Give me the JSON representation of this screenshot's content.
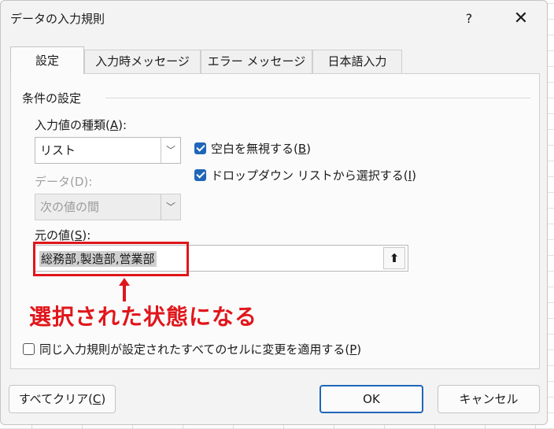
{
  "dialog": {
    "title": "データの入力規則",
    "help_label": "?",
    "close_label": "✕"
  },
  "tabs": [
    {
      "label": "設定",
      "active": true
    },
    {
      "label": "入力時メッセージ",
      "active": false
    },
    {
      "label": "エラー メッセージ",
      "active": false
    },
    {
      "label": "日本語入力",
      "active": false
    }
  ],
  "settings": {
    "group_label": "条件の設定",
    "allow_label_prefix": "入力値の種類(",
    "allow_label_key": "A",
    "allow_label_suffix": "):",
    "allow_value": "リスト",
    "data_label": "データ(D):",
    "data_value": "次の値の間",
    "ignore_blank_prefix": "空白を無視する(",
    "ignore_blank_key": "B",
    "ignore_blank_suffix": ")",
    "ignore_blank_checked": true,
    "dropdown_prefix": "ドロップダウン リストから選択する(",
    "dropdown_key": "I",
    "dropdown_suffix": ")",
    "dropdown_checked": true,
    "source_label_prefix": "元の値(",
    "source_label_key": "S",
    "source_label_suffix": "):",
    "source_value": "総務部,製造部,営業部",
    "collapse_icon": "⬆",
    "apply_all_prefix": "同じ入力規則が設定されたすべてのセルに変更を適用する(",
    "apply_all_key": "P",
    "apply_all_suffix": ")",
    "apply_all_checked": false
  },
  "annotation": {
    "text": "選択された状態になる",
    "color": "#e0161b"
  },
  "footer": {
    "clear_prefix": "すべてクリア(",
    "clear_key": "C",
    "clear_suffix": ")",
    "ok_label": "OK",
    "cancel_label": "キャンセル"
  },
  "colors": {
    "accent": "#1f66b8",
    "highlight": "#e0161b"
  }
}
